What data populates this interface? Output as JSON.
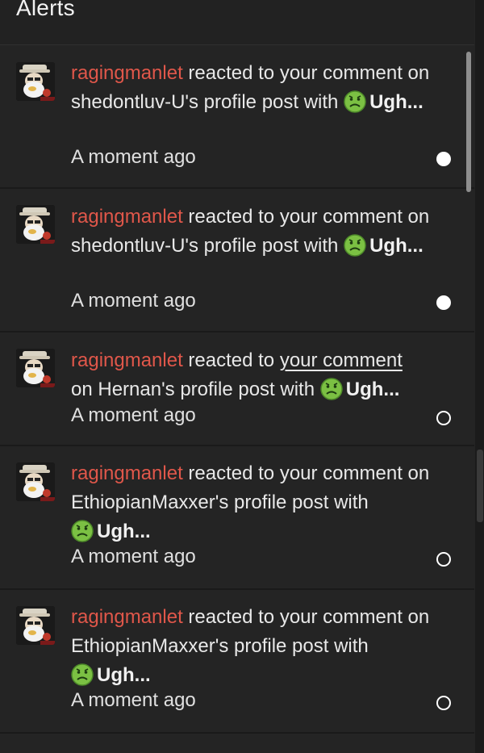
{
  "header": {
    "title": "Alerts"
  },
  "alerts": [
    {
      "username": "ragingmanlet",
      "action": " reacted to your comment on shedontluv-U's profile post with ",
      "reaction": "Ugh...",
      "time": "A moment ago",
      "status": "unread"
    },
    {
      "username": "ragingmanlet",
      "action": " reacted to your comment on shedontluv-U's profile post with ",
      "reaction": "Ugh...",
      "time": "A moment ago",
      "status": "unread"
    },
    {
      "username": "ragingmanlet",
      "action_pre": " reacted to ",
      "action_link": "your comment",
      "action_post": " on Hernan's profile post with ",
      "reaction": "Ugh...",
      "time": "A moment ago",
      "status": "read"
    },
    {
      "username": "ragingmanlet",
      "action": " reacted to your comment on EthiopianMaxxer's profile post with ",
      "reaction": "Ugh...",
      "time": "A moment ago",
      "status": "read"
    },
    {
      "username": "ragingmanlet",
      "action": " reacted to your comment on EthiopianMaxxer's profile post with ",
      "reaction": "Ugh...",
      "time": "A moment ago",
      "status": "read"
    }
  ],
  "icons": {
    "avatar": "avatar-image",
    "reaction": "sick-face-icon",
    "unread_marker": "unread-dot-icon",
    "read_marker": "read-circle-icon"
  },
  "colors": {
    "background": "#242424",
    "username": "#e0574a",
    "reaction_emoji": "#7bc043",
    "text": "#e8e8e8"
  }
}
